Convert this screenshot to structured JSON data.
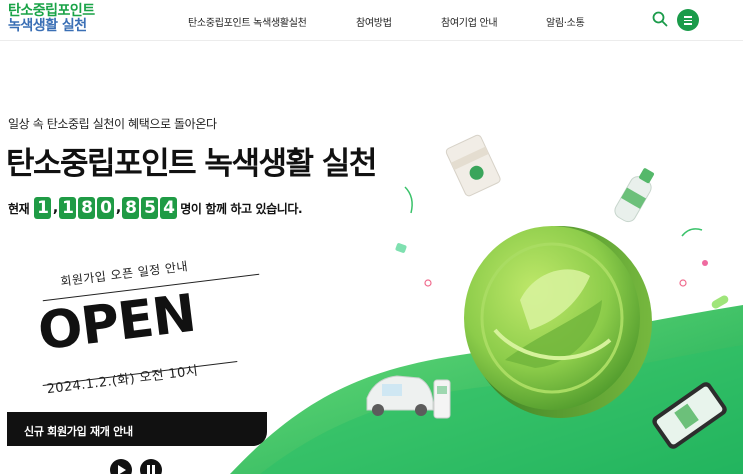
{
  "header": {
    "logo_line1": "탄소중립포인트",
    "logo_line2": "녹색생활 실천",
    "nav": [
      "탄소중립포인트 녹색생활실천",
      "참여방법",
      "참여기업 안내",
      "알림·소통"
    ]
  },
  "hero": {
    "subtitle": "일상 속 탄소중립 실천이 혜택으로 돌아온다",
    "title": "탄소중립포인트 녹색생활 실천",
    "counter_prefix": "현재",
    "counter_digits": [
      "1",
      "1",
      "8",
      "0",
      "8",
      "5",
      "4"
    ],
    "counter_separator": ",",
    "counter_suffix": "명이 함께 하고 있습니다."
  },
  "banner": {
    "top_text": "회원가입 오픈 일정 안내",
    "big_text": "OPEN",
    "date_text": "2024.1.2.(화) 오전 10시",
    "notice": "신규 회원가입 재개 안내"
  },
  "icons": {
    "search": "search-icon",
    "menu": "menu-icon",
    "play": "play-icon",
    "pause": "pause-icon"
  },
  "colors": {
    "brand_green": "#1f9b45",
    "logo_blue": "#3a6fb5",
    "hill_green": "#2fbf63",
    "coin_green": "#8fd14f"
  }
}
